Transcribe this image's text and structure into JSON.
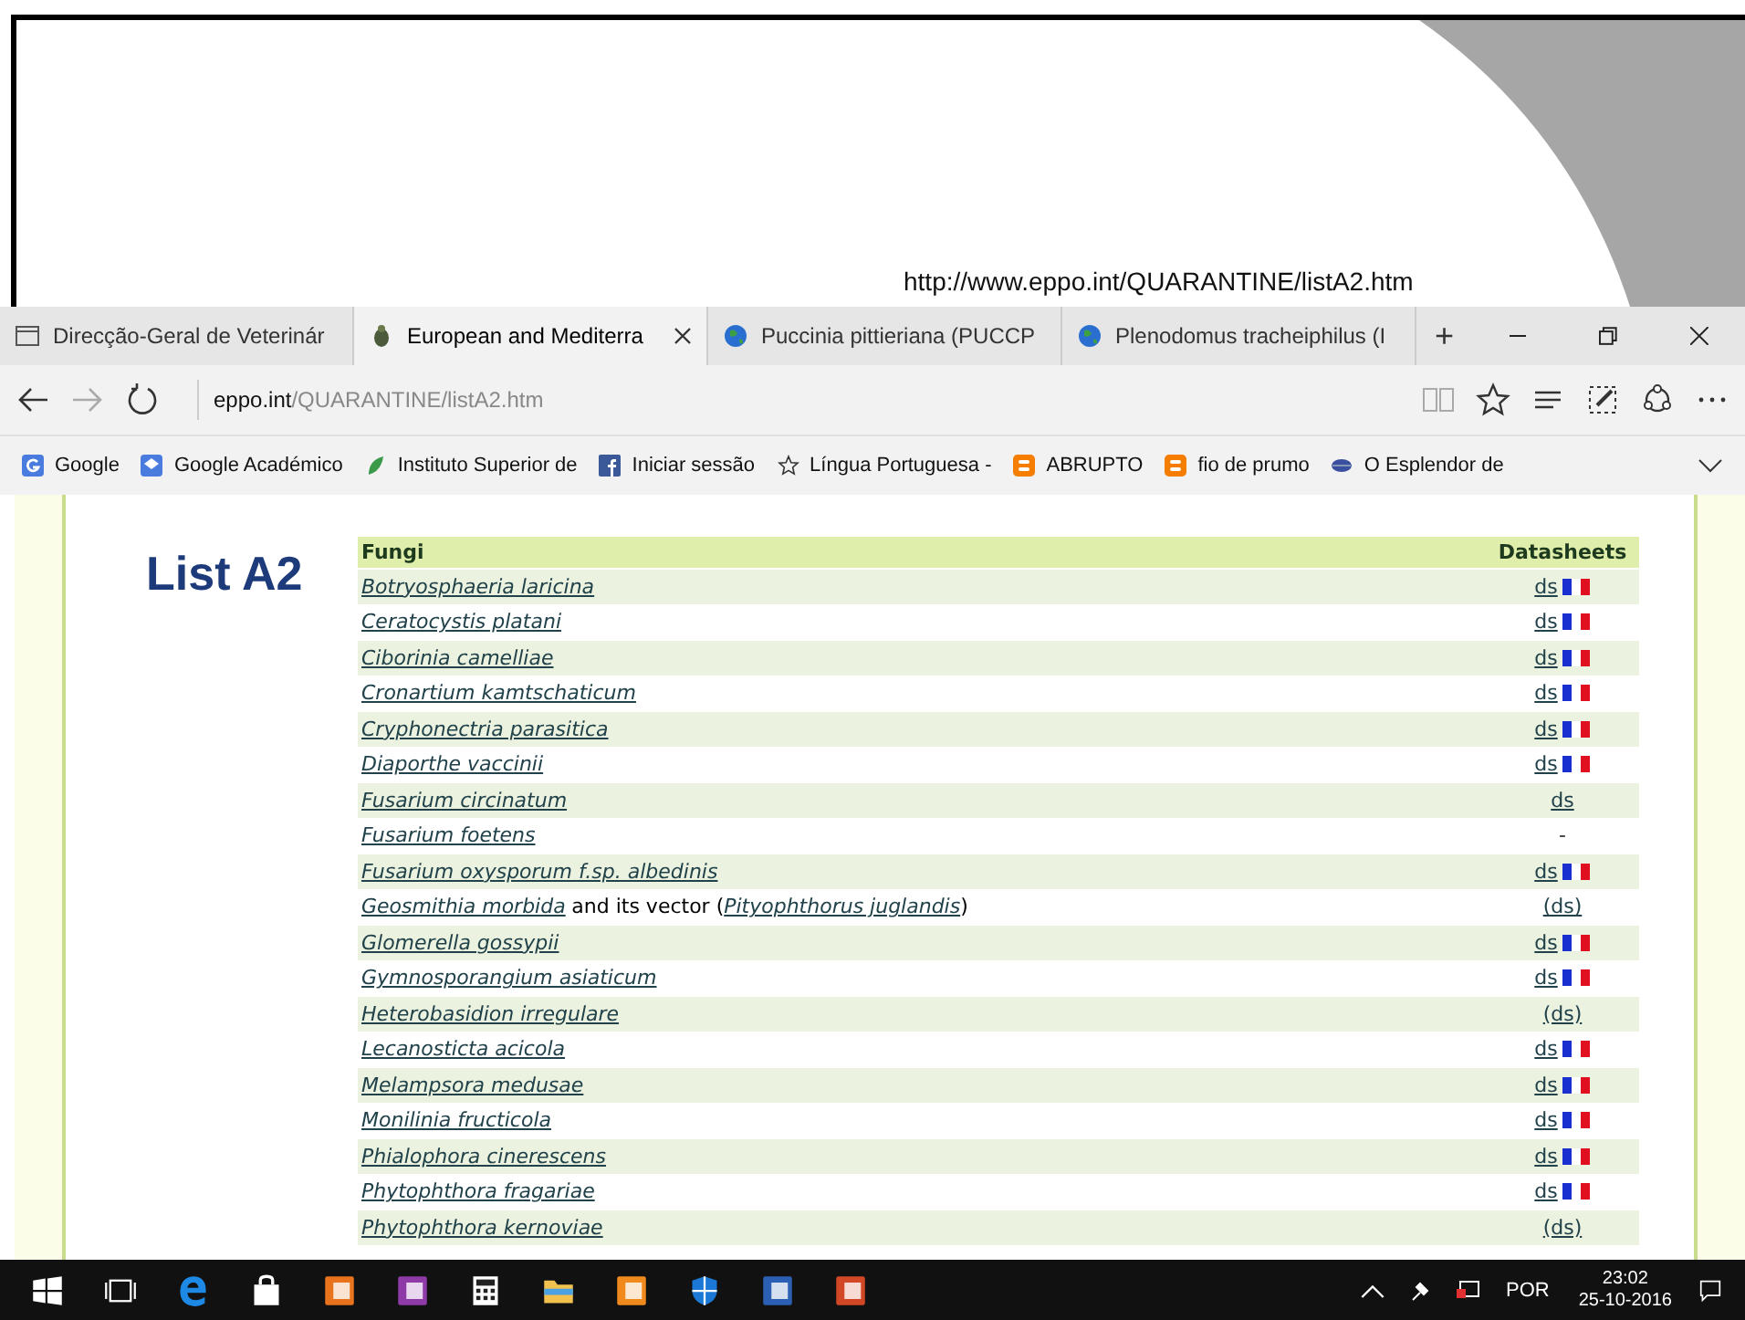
{
  "slide": {
    "caption": "http://www.eppo.int/QUARANTINE/listA2.htm"
  },
  "tabs": [
    {
      "title": "Direcção-Geral de Veterinár",
      "selected": false
    },
    {
      "title": "European and Mediterra",
      "selected": true
    },
    {
      "title": "Puccinia pittieriana (PUCCP",
      "selected": false
    },
    {
      "title": "Plenodomus tracheiphilus (I",
      "selected": false
    }
  ],
  "new_tab": "+",
  "address": {
    "host": "eppo.int",
    "path": "/QUARANTINE/listA2.htm"
  },
  "bookmarks": [
    "Google",
    "Google Académico",
    "Instituto Superior de",
    "Iniciar sessão",
    "Língua Portuguesa -",
    "ABRUPTO",
    "fio de prumo",
    "O Esplendor de"
  ],
  "page": {
    "heading": "List A2",
    "table": {
      "columns": [
        "Fungi",
        "Datasheets"
      ],
      "rows": [
        {
          "name": [
            {
              "kind": "link",
              "text": "Botryosphaeria laricina"
            }
          ],
          "ds": "ds",
          "kind": "ds_flag"
        },
        {
          "name": [
            {
              "kind": "link",
              "text": "Ceratocystis platani"
            }
          ],
          "ds": "ds",
          "kind": "ds_flag"
        },
        {
          "name": [
            {
              "kind": "link",
              "text": "Ciborinia camelliae"
            }
          ],
          "ds": "ds",
          "kind": "ds_flag"
        },
        {
          "name": [
            {
              "kind": "link",
              "text": "Cronartium kamtschaticum"
            }
          ],
          "ds": "ds",
          "kind": "ds_flag"
        },
        {
          "name": [
            {
              "kind": "link",
              "text": "Cryphonectria parasitica"
            }
          ],
          "ds": "ds",
          "kind": "ds_flag"
        },
        {
          "name": [
            {
              "kind": "link",
              "text": "Diaporthe vaccinii"
            }
          ],
          "ds": "ds",
          "kind": "ds_flag"
        },
        {
          "name": [
            {
              "kind": "link",
              "text": "Fusarium circinatum"
            }
          ],
          "ds": "ds",
          "kind": "ds"
        },
        {
          "name": [
            {
              "kind": "link",
              "text": "Fusarium foetens"
            }
          ],
          "ds": "-",
          "kind": "none"
        },
        {
          "name": [
            {
              "kind": "link",
              "text": "Fusarium oxysporum f.sp. albedinis"
            }
          ],
          "ds": "ds",
          "kind": "ds_flag"
        },
        {
          "name": [
            {
              "kind": "link",
              "text": "Geosmithia morbida"
            },
            {
              "kind": "text",
              "text": "and its vector ("
            },
            {
              "kind": "link",
              "text": "Pityophthorus juglandis"
            },
            {
              "kind": "text",
              "text": ")"
            }
          ],
          "ds": "(ds)",
          "kind": "ds"
        },
        {
          "name": [
            {
              "kind": "link",
              "text": "Glomerella gossypii"
            }
          ],
          "ds": "ds",
          "kind": "ds_flag"
        },
        {
          "name": [
            {
              "kind": "link",
              "text": "Gymnosporangium asiaticum"
            }
          ],
          "ds": "ds",
          "kind": "ds_flag"
        },
        {
          "name": [
            {
              "kind": "link",
              "text": "Heterobasidion irregulare"
            }
          ],
          "ds": "(ds)",
          "kind": "ds"
        },
        {
          "name": [
            {
              "kind": "link",
              "text": "Lecanosticta acicola"
            }
          ],
          "ds": "ds",
          "kind": "ds_flag"
        },
        {
          "name": [
            {
              "kind": "link",
              "text": "Melampsora medusae"
            }
          ],
          "ds": "ds",
          "kind": "ds_flag"
        },
        {
          "name": [
            {
              "kind": "link",
              "text": "Monilinia fructicola"
            }
          ],
          "ds": "ds",
          "kind": "ds_flag"
        },
        {
          "name": [
            {
              "kind": "link",
              "text": "Phialophora cinerescens"
            }
          ],
          "ds": "ds",
          "kind": "ds_flag"
        },
        {
          "name": [
            {
              "kind": "link",
              "text": "Phytophthora fragariae"
            }
          ],
          "ds": "ds",
          "kind": "ds_flag"
        },
        {
          "name": [
            {
              "kind": "link",
              "text": "Phytophthora kernoviae"
            }
          ],
          "ds": "(ds)",
          "kind": "ds"
        }
      ]
    }
  },
  "taskbar": {
    "language": "POR",
    "time": "23:02",
    "date": "25-10-2016"
  }
}
